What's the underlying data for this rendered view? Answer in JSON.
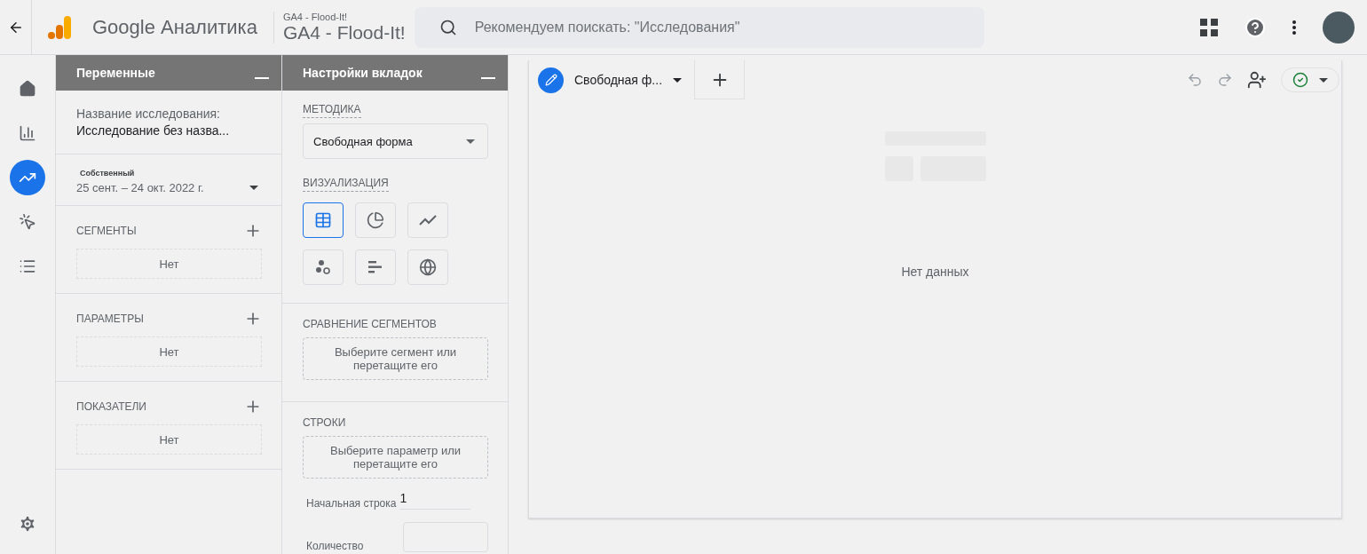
{
  "header": {
    "app_name": "Google Аналитика",
    "property_account": "GA4 - Flood-It!",
    "property_name": "GA4 - Flood-It!",
    "search_placeholder": "Рекомендуем поискать: \"Исследования\""
  },
  "nav": [
    {
      "kind": "home",
      "selected": false
    },
    {
      "kind": "reports",
      "selected": false
    },
    {
      "kind": "explore",
      "selected": true
    },
    {
      "kind": "advertising",
      "selected": false
    },
    {
      "kind": "configure",
      "selected": false
    }
  ],
  "variables": {
    "title": "Переменные",
    "exploration_label": "Название исследования:",
    "exploration_name": "Исследование без назва...",
    "date_kind": "Собственный",
    "date_range": "25 сент. – 24 окт. 2022 г.",
    "sections": [
      {
        "title": "СЕГМЕНТЫ",
        "empty": "Нет"
      },
      {
        "title": "ПАРАМЕТРЫ",
        "empty": "Нет"
      },
      {
        "title": "ПОКАЗАТЕЛИ",
        "empty": "Нет"
      }
    ]
  },
  "tab_settings": {
    "title": "Настройки вкладок",
    "technique_label": "МЕТОДИКА",
    "technique_value": "Свободная форма",
    "visualization_label": "ВИЗУАЛИЗАЦИЯ",
    "visualizations": [
      {
        "kind": "table",
        "selected": true
      },
      {
        "kind": "donut",
        "selected": false
      },
      {
        "kind": "line",
        "selected": false
      },
      {
        "kind": "scatter",
        "selected": false
      },
      {
        "kind": "bar",
        "selected": false
      },
      {
        "kind": "geo",
        "selected": false
      }
    ],
    "segment_comparison": {
      "title": "СРАВНЕНИЕ СЕГМЕНТОВ",
      "placeholder": "Выберите сегмент или перетащите его"
    },
    "rows": {
      "title": "СТРОКИ",
      "placeholder": "Выберите параметр или перетащите его",
      "start_row_label": "Начальная строка",
      "start_row_value": "1",
      "count_label": "Количество"
    }
  },
  "canvas": {
    "tab_label": "Свободная ф...",
    "empty_text": "Нет данных"
  }
}
